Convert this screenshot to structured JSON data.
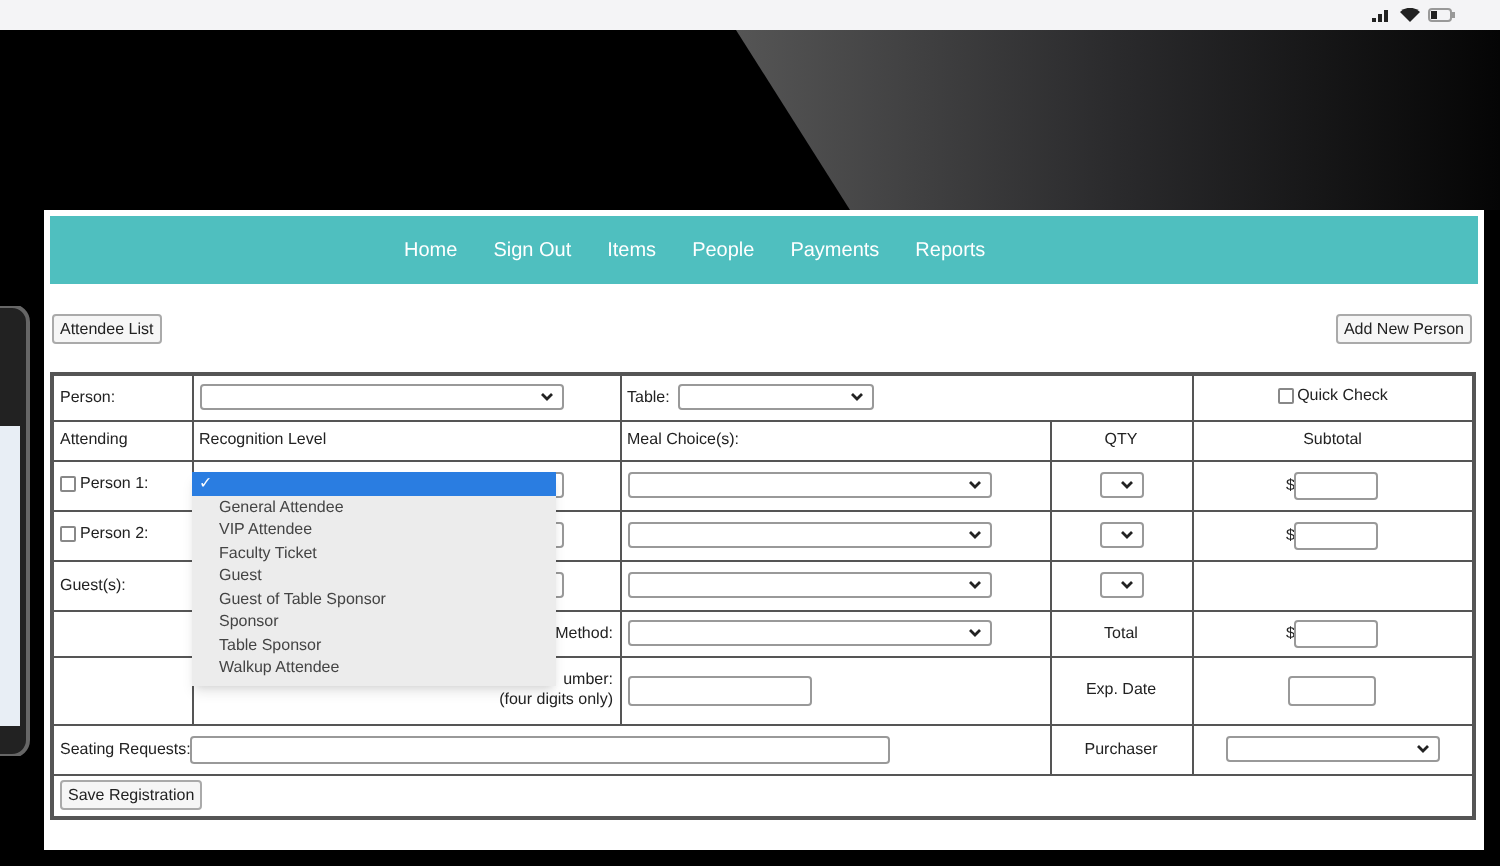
{
  "nav": [
    "Home",
    "Sign Out",
    "Items",
    "People",
    "Payments",
    "Reports"
  ],
  "attendee_list_button": "Attendee List",
  "add_person_button": "Add New Person",
  "form": {
    "person_label": "Person:",
    "table_label": "Table:",
    "quick_check": {
      "label": "Quick Check",
      "checked": false
    },
    "headers": [
      "Attending",
      "Recognition Level",
      "Meal Choice(s):",
      "QTY",
      "Subtotal"
    ],
    "attendees": [
      {
        "label": "Person 1:",
        "checked": false
      },
      {
        "label": "Person 2:",
        "checked": false
      }
    ],
    "guests_label": "Guest(s):",
    "currency": [
      "$",
      "$",
      "$"
    ],
    "method_label": "Method:",
    "total_label": "Total",
    "number_label": "umber:",
    "number_hint": "(four digits only)",
    "exp_label": "Exp. Date",
    "seating_label": "Seating Requests:",
    "purchaser_label": "Purchaser",
    "dropdown": [
      {
        "label": "✓",
        "selected": true
      },
      {
        "label": "General Attendee",
        "selected": false
      },
      {
        "label": "VIP Attendee",
        "selected": false
      },
      {
        "label": "Faculty Ticket",
        "selected": false
      },
      {
        "label": "Guest",
        "selected": false
      },
      {
        "label": "Guest of Table Sponsor",
        "selected": false
      },
      {
        "label": "Sponsor",
        "selected": false
      },
      {
        "label": "Table Sponsor",
        "selected": false
      },
      {
        "label": "Walkup Attendee",
        "selected": false
      }
    ]
  },
  "save_button": "Save Registration"
}
